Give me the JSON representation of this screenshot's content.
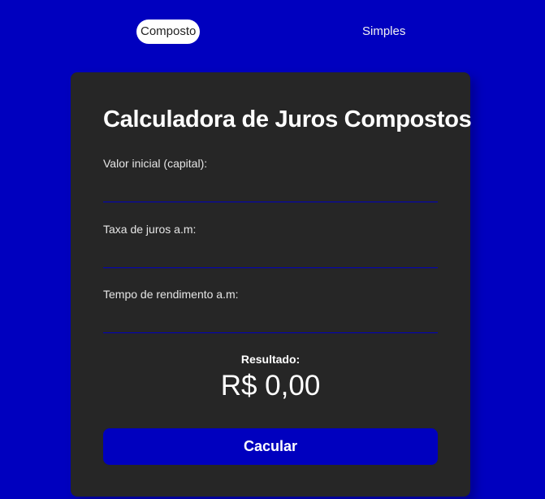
{
  "tabs": [
    {
      "label": "Composto",
      "active": true
    },
    {
      "label": "Simples",
      "active": false
    }
  ],
  "card": {
    "title": "Calculadora de Juros Compostos",
    "fields": [
      {
        "label": "Valor inicial (capital):",
        "value": "",
        "placeholder": ""
      },
      {
        "label": "Taxa de juros a.m:",
        "value": "",
        "placeholder": ""
      },
      {
        "label": "Tempo de rendimento a.m:",
        "value": "",
        "placeholder": ""
      }
    ],
    "result_label": "Resultado:",
    "result_value": "R$ 0,00",
    "button_label": "Cacular"
  },
  "colors": {
    "background": "#0000bf",
    "card": "#262626",
    "accent": "#0000bf",
    "text": "#ffffff"
  }
}
